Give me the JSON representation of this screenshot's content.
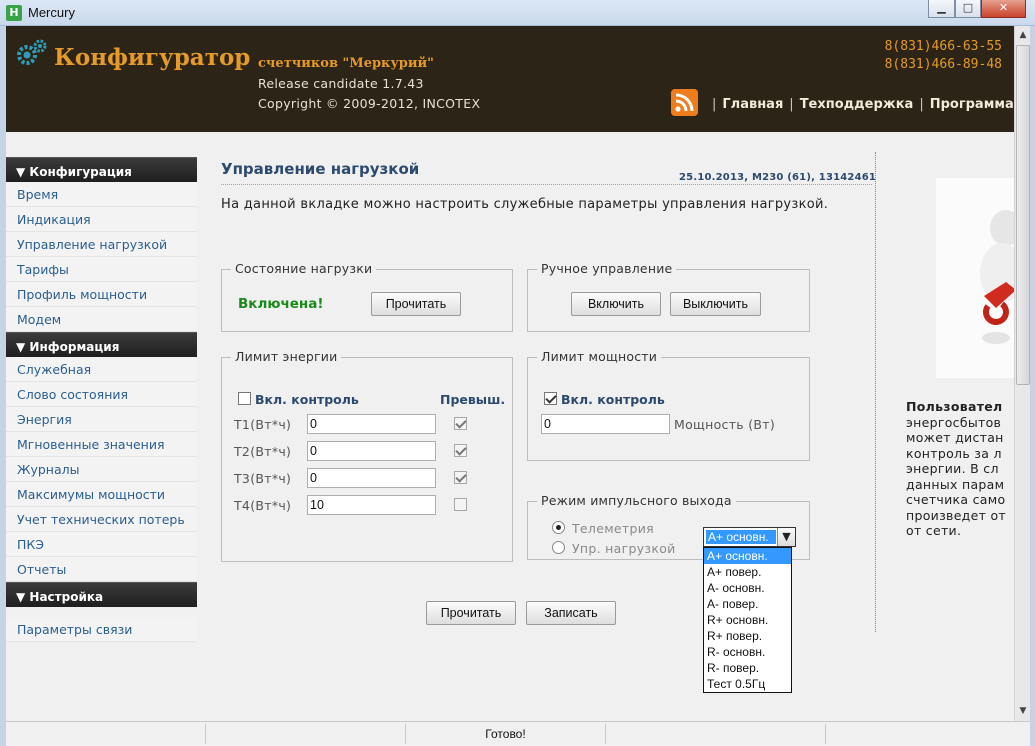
{
  "window": {
    "title": "Mercury",
    "icon_letter": "H",
    "controls": {
      "minimize": "▁",
      "maximize": "□",
      "close": "✕"
    }
  },
  "header": {
    "brand": "Конфигуратор",
    "subtitle": "счетчиков \"Меркурий\"",
    "release": "Release candidate 1.7.43",
    "copyright": "Copyright © 2009-2012, INCOTEX",
    "phones": [
      "8(831)466-63-55",
      "8(831)466-89-48"
    ],
    "nav": {
      "home": "Главная",
      "support": "Техподдержка",
      "program": "Программа",
      "separator": "|"
    }
  },
  "sidebar": {
    "sections": [
      {
        "title": "▼ Конфигурация",
        "items": [
          "Время",
          "Индикация",
          "Управление нагрузкой",
          "Тарифы",
          "Профиль мощности",
          "Модем"
        ]
      },
      {
        "title": "▼ Информация",
        "items": [
          "Служебная",
          "Слово состояния",
          "Энергия",
          "Мгновенные значения",
          "Журналы",
          "Максимумы мощности",
          "Учет технических потерь",
          "ПКЭ",
          "Отчеты"
        ]
      },
      {
        "title": "▼ Настройка",
        "items": [
          "Параметры связи"
        ]
      }
    ]
  },
  "main": {
    "title": "Управление нагрузкой",
    "meta": "25.10.2013, M230 (61), 13142461",
    "description": "На данной вкладке можно настроить служебные параметры управления нагрузкой.",
    "load_state": {
      "legend": "Состояние нагрузки",
      "status": "Включена!",
      "status_color": "#1a8a1a",
      "read_button": "Прочитать"
    },
    "manual": {
      "legend": "Ручное управление",
      "on_button": "Включить",
      "off_button": "Выключить"
    },
    "energy_limit": {
      "legend": "Лимит энергии",
      "enable_label": "Вкл. контроль",
      "enable_checked": false,
      "exceed_label": "Превыш.",
      "rows": [
        {
          "label": "Т1(Вт*ч)",
          "value": "0",
          "exceeded": true
        },
        {
          "label": "Т2(Вт*ч)",
          "value": "0",
          "exceeded": true
        },
        {
          "label": "Т3(Вт*ч)",
          "value": "0",
          "exceeded": true
        },
        {
          "label": "Т4(Вт*ч)",
          "value": "10",
          "exceeded": false
        }
      ]
    },
    "power_limit": {
      "legend": "Лимит мощности",
      "enable_label": "Вкл. контроль",
      "enable_checked": true,
      "value": "0",
      "unit_label": "Мощность (Вт)"
    },
    "pulse_output": {
      "legend": "Режим импульсного выхода",
      "options": [
        "Телеметрия",
        "Упр. нагрузкой"
      ],
      "selected_option": "Телеметрия",
      "select_value": "A+ основн.",
      "dropdown_items": [
        "A+ основн.",
        "A+ повер.",
        "A- основн.",
        "A- повер.",
        "R+ основн.",
        "R+ повер.",
        "R- основн.",
        "R- повер.",
        "Тест 0.5Гц"
      ],
      "dropdown_selected": "A+ основн."
    },
    "read_button": "Прочитать",
    "write_button": "Записать"
  },
  "promo": {
    "heading": "Пользовател",
    "lines": [
      "энергосбытов",
      "может дистан",
      "контроль за л",
      "энергии. В сл",
      "данных парам",
      "счетчика само",
      "произведет от",
      "от сети."
    ]
  },
  "statusbar": {
    "text": "Готово!"
  },
  "colors": {
    "header_bg": "#2b2417",
    "brand": "#e59a2a",
    "link": "#2a5e8f",
    "select_highlight": "#3399ff"
  }
}
